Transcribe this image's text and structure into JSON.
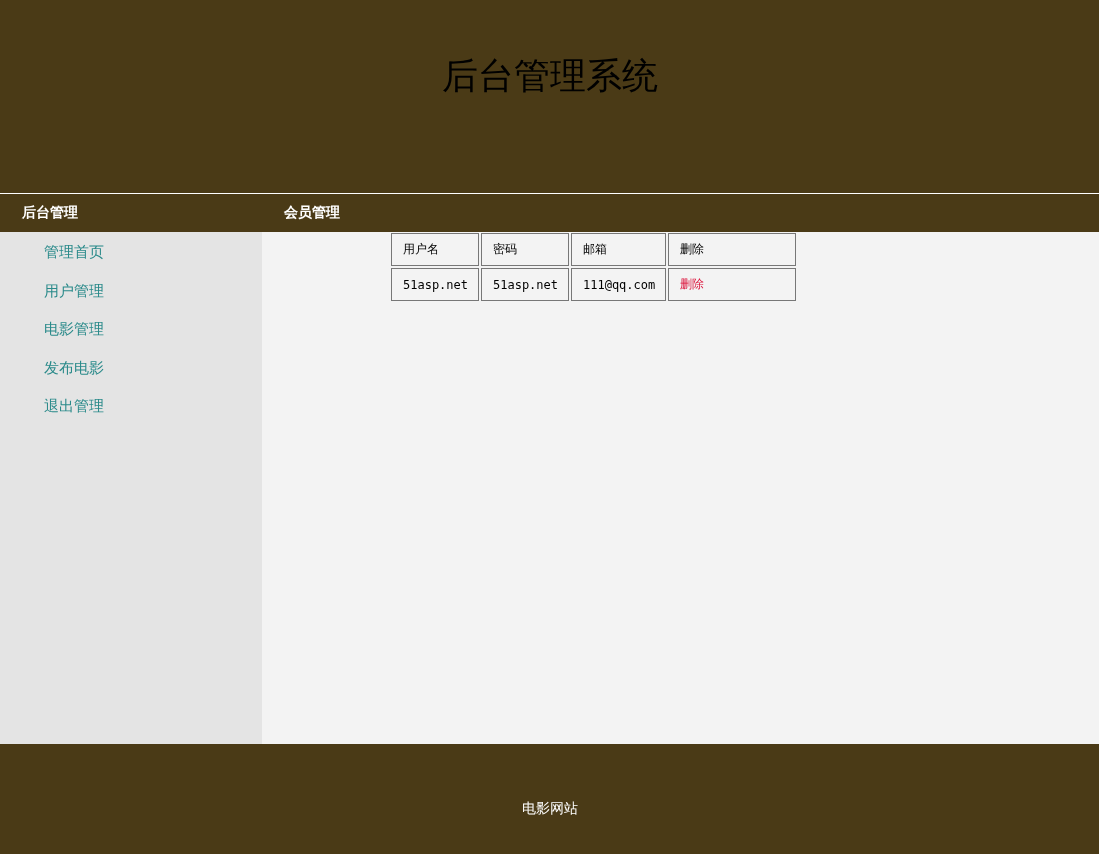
{
  "header": {
    "title": "后台管理系统"
  },
  "sidebar": {
    "title": "后台管理",
    "items": [
      {
        "label": "管理首页"
      },
      {
        "label": "用户管理"
      },
      {
        "label": "电影管理"
      },
      {
        "label": "发布电影"
      },
      {
        "label": "退出管理"
      }
    ]
  },
  "content": {
    "title": "会员管理",
    "table": {
      "columns": [
        "用户名",
        "密码",
        "邮箱",
        "删除"
      ],
      "rows": [
        {
          "cells": [
            "51asp.net",
            "51asp.net",
            "111@qq.com"
          ],
          "action": "删除"
        }
      ]
    }
  },
  "footer": {
    "text": "电影网站"
  }
}
